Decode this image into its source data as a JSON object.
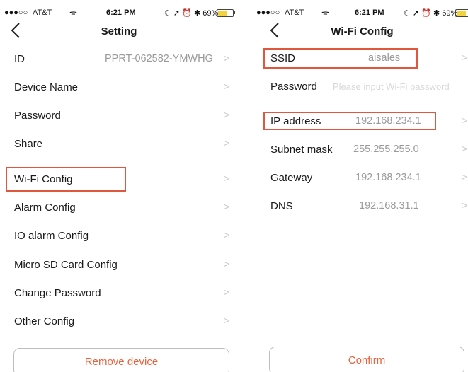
{
  "left_screen": {
    "status": {
      "signal": "●●●○○",
      "carrier": "AT&T",
      "wifi": "ᯤ",
      "time": "6:21 PM",
      "icons": "☾ ➚ ⏰ ✱ 69%",
      "battery_level": 0.69
    },
    "title": "Setting",
    "rows": [
      {
        "label": "ID",
        "value": "PPRT-062582-YMWHG"
      },
      {
        "label": "Device Name"
      },
      {
        "label": "Password"
      },
      {
        "label": "Share"
      },
      {
        "label": "Wi-Fi Config",
        "highlighted": true
      },
      {
        "label": "Alarm Config"
      },
      {
        "label": "IO alarm Config"
      },
      {
        "label": "Micro SD Card Config"
      },
      {
        "label": "Change Password"
      },
      {
        "label": "Other Config"
      }
    ],
    "chevron": ">",
    "remove_button": "Remove device"
  },
  "right_screen": {
    "status": {
      "signal": "●●●○○",
      "carrier": "AT&T",
      "wifi": "ᯤ",
      "time": "6:21 PM",
      "icons": "☾ ➚ ⏰ ✱ 69%",
      "battery_level": 0.69
    },
    "title": "Wi-Fi Config",
    "fields": [
      {
        "label": "SSID",
        "value": "aisales",
        "highlighted": true
      },
      {
        "label": "Password",
        "placeholder": "Please input Wi-Fi password"
      },
      {
        "label": "IP address",
        "value": "192.168.234.1",
        "highlighted": true
      },
      {
        "label": "Subnet mask",
        "value": "255.255.255.0"
      },
      {
        "label": "Gateway",
        "value": "192.168.234.1"
      },
      {
        "label": "DNS",
        "value": "192.168.31.1"
      }
    ],
    "chevron": ">",
    "confirm_button": "Confirm"
  },
  "colors": {
    "highlight": "#e1573d",
    "accent_text": "#e8633f",
    "battery": "#f3d23c"
  }
}
